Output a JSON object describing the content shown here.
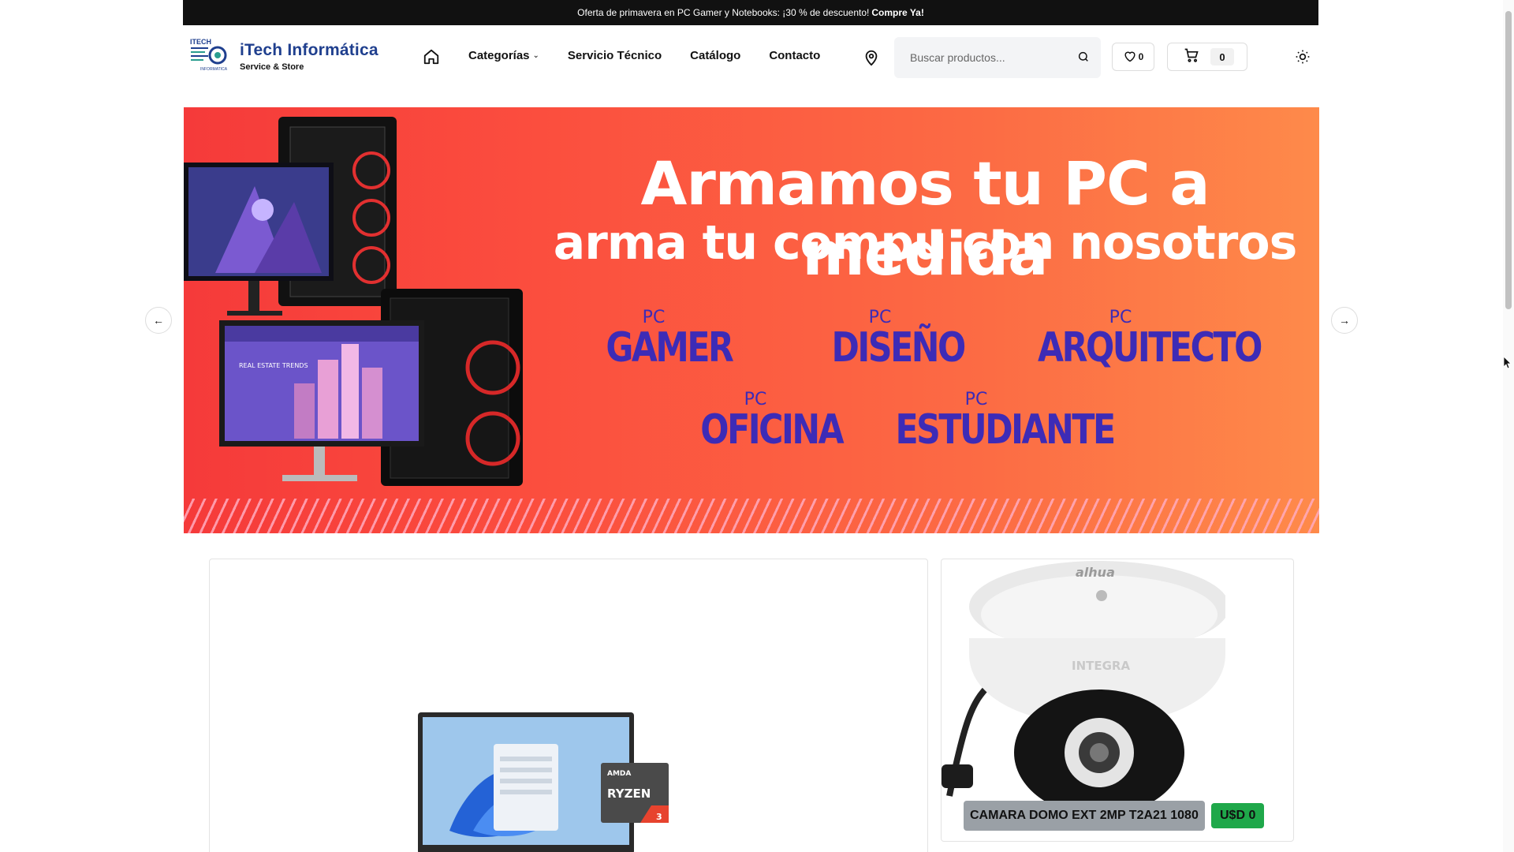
{
  "promo": {
    "text": "Oferta de primavera en PC Gamer y Notebooks: ¡30 % de descuento!",
    "cta": "Compre Ya!"
  },
  "brand": {
    "name": "iTech Informática",
    "tagline": "Service & Store",
    "logo_text": "ITECH",
    "logo_sub": "INFORMATICA"
  },
  "nav": {
    "home_icon": "home-icon",
    "items": [
      "Categorías",
      "Servicio Técnico",
      "Catálogo",
      "Contacto"
    ]
  },
  "search": {
    "placeholder": "Buscar productos..."
  },
  "wishlist": {
    "count": "0"
  },
  "cart": {
    "count": "0"
  },
  "hero": {
    "headline": "Armamos tu PC a medida",
    "subheadline": "arma tu compu con nosotros",
    "pc_prefix": "PC",
    "types": [
      "GAMER",
      "DISEÑO",
      "ARQUITECTO",
      "OFICINA",
      "ESTUDIANTE"
    ],
    "screen_title": "REAL ESTATE TRENDS",
    "colors": {
      "start": "#f53a3a",
      "end": "#fe8a4a",
      "type_text": "#3d2bb6"
    }
  },
  "products": [
    {
      "name": "",
      "badge": "AMD RYZEN 3",
      "badge_brand": "AMDA",
      "badge_model": "RYZEN",
      "badge_number": "3"
    },
    {
      "name": "CAMARA DOMO EXT 2MP T2A21 1080",
      "price": "U$D 0",
      "brand": "alhua",
      "model": "INTEGRA"
    }
  ]
}
